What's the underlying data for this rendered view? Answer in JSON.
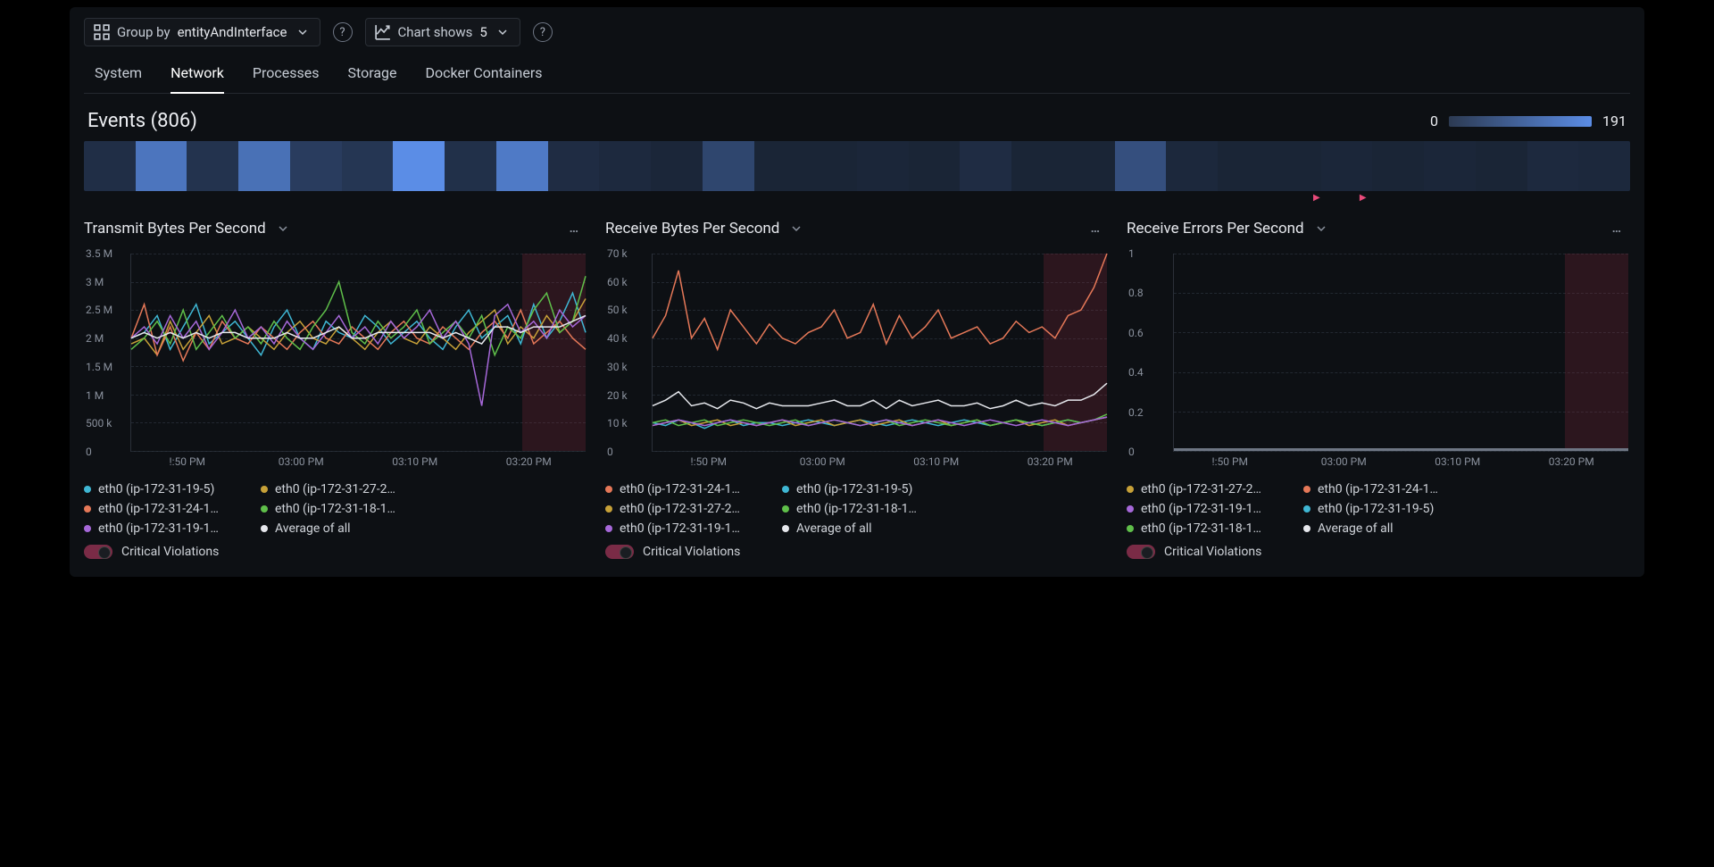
{
  "toolbar": {
    "group_by_label": "Group by",
    "group_by_value": "entityAndInterface",
    "chart_shows_label": "Chart shows",
    "chart_shows_value": "5"
  },
  "tabs": [
    "System",
    "Network",
    "Processes",
    "Storage",
    "Docker Containers"
  ],
  "active_tab": "Network",
  "events": {
    "title": "Events (806)",
    "scale_min": "0",
    "scale_max": "191",
    "heatmap": [
      20,
      95,
      25,
      90,
      35,
      28,
      120,
      22,
      100,
      18,
      15,
      12,
      45,
      10,
      10,
      12,
      10,
      18,
      10,
      10,
      55,
      14,
      10,
      10,
      12,
      10,
      12,
      10,
      15,
      14
    ]
  },
  "charts": [
    {
      "title": "Transmit Bytes Per Second",
      "legend": [
        {
          "color": "#3fb7d4",
          "label": "eth0 (ip-172-31-19-5)"
        },
        {
          "color": "#c7a138",
          "label": "eth0 (ip-172-31-27-2…"
        },
        {
          "color": "#e57858",
          "label": "eth0 (ip-172-31-24-1…"
        },
        {
          "color": "#5fbf4a",
          "label": "eth0 (ip-172-31-18-1…"
        },
        {
          "color": "#a668d9",
          "label": "eth0 (ip-172-31-19-1…"
        },
        {
          "color": "#e6e8ed",
          "label": "Average of all"
        }
      ],
      "critical_label": "Critical Violations"
    },
    {
      "title": "Receive Bytes Per Second",
      "legend": [
        {
          "color": "#e57858",
          "label": "eth0 (ip-172-31-24-1…"
        },
        {
          "color": "#3fb7d4",
          "label": "eth0 (ip-172-31-19-5)"
        },
        {
          "color": "#c7a138",
          "label": "eth0 (ip-172-31-27-2…"
        },
        {
          "color": "#5fbf4a",
          "label": "eth0 (ip-172-31-18-1…"
        },
        {
          "color": "#a668d9",
          "label": "eth0 (ip-172-31-19-1…"
        },
        {
          "color": "#e6e8ed",
          "label": "Average of all"
        }
      ],
      "critical_label": "Critical Violations"
    },
    {
      "title": "Receive Errors Per Second",
      "legend": [
        {
          "color": "#c7a138",
          "label": "eth0 (ip-172-31-27-2…"
        },
        {
          "color": "#e57858",
          "label": "eth0 (ip-172-31-24-1…"
        },
        {
          "color": "#a668d9",
          "label": "eth0 (ip-172-31-19-1…"
        },
        {
          "color": "#3fb7d4",
          "label": "eth0 (ip-172-31-19-5)"
        },
        {
          "color": "#5fbf4a",
          "label": "eth0 (ip-172-31-18-1…"
        },
        {
          "color": "#e6e8ed",
          "label": "Average of all"
        }
      ],
      "critical_label": "Critical Violations"
    }
  ],
  "chart_data": [
    {
      "type": "line",
      "title": "Transmit Bytes Per Second",
      "xlabel": "",
      "ylabel": "",
      "ylim": [
        0,
        3500000
      ],
      "y_ticks": [
        "3.5 M",
        "3 M",
        "2.5 M",
        "2 M",
        "1.5 M",
        "1 M",
        "500 k",
        "0"
      ],
      "x_ticks": [
        "!:50 PM",
        "03:00 PM",
        "03:10 PM",
        "03:20 PM"
      ],
      "x": [
        0,
        1,
        2,
        3,
        4,
        5,
        6,
        7,
        8,
        9,
        10,
        11,
        12,
        13,
        14,
        15,
        16,
        17,
        18,
        19,
        20,
        21,
        22,
        23,
        24,
        25,
        26,
        27,
        28,
        29,
        30,
        31,
        32,
        33,
        34,
        35
      ],
      "series": [
        {
          "name": "eth0 (ip-172-31-19-5)",
          "color": "#3fb7d4",
          "values": [
            2.0,
            2.1,
            2.4,
            1.8,
            2.2,
            2.6,
            1.9,
            2.1,
            2.3,
            2.0,
            1.7,
            2.2,
            2.5,
            2.0,
            1.8,
            2.3,
            2.1,
            2.0,
            2.4,
            2.2,
            1.9,
            2.1,
            2.3,
            2.0,
            1.8,
            2.2,
            2.5,
            2.0,
            2.2,
            2.4,
            1.9,
            2.6,
            2.0,
            2.3,
            2.8,
            2.1
          ]
        },
        {
          "name": "eth0 (ip-172-31-27-2)",
          "color": "#c7a138",
          "values": [
            1.9,
            2.0,
            1.7,
            2.3,
            1.8,
            2.1,
            2.4,
            1.9,
            2.0,
            2.2,
            2.0,
            1.8,
            2.1,
            2.3,
            2.0,
            1.9,
            2.2,
            2.0,
            1.8,
            2.1,
            2.3,
            2.0,
            1.9,
            2.2,
            2.0,
            1.8,
            2.1,
            2.3,
            2.5,
            1.9,
            2.2,
            2.0,
            2.4,
            2.1,
            2.3,
            2.7
          ]
        },
        {
          "name": "eth0 (ip-172-31-24-1)",
          "color": "#e57858",
          "values": [
            2.0,
            2.6,
            1.7,
            2.2,
            1.6,
            2.1,
            1.8,
            2.3,
            2.0,
            1.9,
            2.2,
            2.0,
            1.8,
            2.1,
            2.3,
            2.0,
            1.9,
            2.2,
            2.0,
            1.8,
            2.1,
            2.3,
            2.0,
            1.9,
            2.2,
            2.0,
            1.8,
            2.1,
            2.3,
            2.0,
            2.5,
            1.9,
            2.1,
            2.3,
            2.0,
            1.8
          ]
        },
        {
          "name": "eth0 (ip-172-31-18-1)",
          "color": "#5fbf4a",
          "values": [
            1.8,
            2.0,
            2.3,
            1.9,
            2.5,
            1.8,
            2.1,
            2.4,
            2.0,
            2.2,
            1.9,
            2.3,
            2.0,
            1.8,
            2.2,
            2.5,
            3.0,
            2.1,
            1.9,
            2.3,
            2.0,
            2.2,
            2.5,
            1.9,
            2.1,
            2.3,
            2.0,
            2.4,
            1.7,
            2.2,
            2.0,
            2.5,
            2.8,
            2.1,
            2.3,
            3.1
          ]
        },
        {
          "name": "eth0 (ip-172-31-19-1)",
          "color": "#a668d9",
          "values": [
            2.0,
            2.2,
            1.9,
            2.4,
            2.0,
            2.3,
            1.8,
            2.1,
            2.5,
            2.0,
            2.2,
            1.9,
            2.3,
            2.0,
            1.8,
            2.1,
            2.4,
            2.0,
            2.2,
            1.9,
            2.3,
            2.0,
            2.2,
            2.5,
            2.0,
            2.3,
            1.9,
            0.8,
            2.4,
            2.6,
            2.1,
            2.3,
            2.0,
            2.5,
            2.2,
            2.4
          ]
        },
        {
          "name": "Average of all",
          "color": "#e6e8ed",
          "values": [
            2.0,
            2.1,
            2.0,
            2.1,
            2.0,
            2.1,
            2.0,
            2.1,
            2.1,
            2.0,
            2.0,
            2.0,
            2.1,
            2.0,
            2.0,
            2.1,
            2.2,
            2.0,
            2.0,
            2.1,
            2.1,
            2.1,
            2.1,
            2.1,
            2.0,
            2.1,
            2.0,
            1.9,
            2.2,
            2.2,
            2.1,
            2.2,
            2.2,
            2.2,
            2.3,
            2.4
          ]
        }
      ],
      "critical_band": {
        "start_frac": 0.86,
        "end_frac": 1.0
      }
    },
    {
      "type": "line",
      "title": "Receive Bytes Per Second",
      "xlabel": "",
      "ylabel": "",
      "ylim": [
        0,
        70000
      ],
      "y_ticks": [
        "70 k",
        "60 k",
        "50 k",
        "40 k",
        "30 k",
        "20 k",
        "10 k",
        "0"
      ],
      "x_ticks": [
        "!:50 PM",
        "03:00 PM",
        "03:10 PM",
        "03:20 PM"
      ],
      "x": [
        0,
        1,
        2,
        3,
        4,
        5,
        6,
        7,
        8,
        9,
        10,
        11,
        12,
        13,
        14,
        15,
        16,
        17,
        18,
        19,
        20,
        21,
        22,
        23,
        24,
        25,
        26,
        27,
        28,
        29,
        30,
        31,
        32,
        33,
        34,
        35
      ],
      "series": [
        {
          "name": "eth0 (ip-172-31-24-1)",
          "color": "#e57858",
          "values": [
            40,
            48,
            64,
            40,
            47,
            36,
            50,
            44,
            38,
            45,
            40,
            38,
            42,
            44,
            50,
            40,
            42,
            52,
            38,
            48,
            40,
            44,
            50,
            40,
            42,
            44,
            38,
            40,
            46,
            42,
            44,
            40,
            48,
            50,
            58,
            70
          ]
        },
        {
          "name": "eth0 (ip-172-31-19-5)",
          "color": "#3fb7d4",
          "values": [
            10,
            9,
            11,
            10,
            8,
            10,
            11,
            9,
            10,
            10,
            9,
            10,
            11,
            10,
            9,
            10,
            11,
            10,
            9,
            10,
            11,
            10,
            9,
            10,
            11,
            10,
            9,
            10,
            11,
            10,
            9,
            10,
            11,
            10,
            11,
            12
          ]
        },
        {
          "name": "eth0 (ip-172-31-27-2)",
          "color": "#c7a138",
          "values": [
            9,
            10,
            11,
            9,
            10,
            11,
            9,
            10,
            9,
            10,
            11,
            9,
            10,
            11,
            9,
            10,
            11,
            9,
            10,
            11,
            9,
            10,
            11,
            9,
            10,
            11,
            9,
            10,
            11,
            9,
            10,
            11,
            9,
            10,
            11,
            12
          ]
        },
        {
          "name": "eth0 (ip-172-31-18-1)",
          "color": "#5fbf4a",
          "values": [
            10,
            11,
            9,
            10,
            11,
            9,
            10,
            11,
            10,
            9,
            10,
            11,
            9,
            10,
            11,
            10,
            9,
            10,
            11,
            9,
            10,
            11,
            10,
            9,
            10,
            11,
            9,
            10,
            11,
            10,
            9,
            10,
            11,
            10,
            11,
            13
          ]
        },
        {
          "name": "eth0 (ip-172-31-19-1)",
          "color": "#a668d9",
          "values": [
            9,
            10,
            11,
            10,
            9,
            10,
            11,
            10,
            9,
            10,
            11,
            10,
            9,
            10,
            11,
            10,
            9,
            10,
            11,
            10,
            9,
            10,
            11,
            10,
            9,
            10,
            11,
            10,
            9,
            10,
            11,
            10,
            9,
            10,
            11,
            12
          ]
        },
        {
          "name": "Average of all",
          "color": "#e6e8ed",
          "values": [
            16,
            18,
            21,
            16,
            17,
            15,
            18,
            17,
            15,
            17,
            16,
            16,
            16,
            17,
            18,
            16,
            16,
            18,
            15,
            18,
            16,
            17,
            18,
            16,
            16,
            17,
            15,
            16,
            18,
            16,
            17,
            16,
            18,
            18,
            20,
            24
          ]
        }
      ],
      "critical_band": {
        "start_frac": 0.86,
        "end_frac": 1.0
      }
    },
    {
      "type": "line",
      "title": "Receive Errors Per Second",
      "xlabel": "",
      "ylabel": "",
      "ylim": [
        0,
        1
      ],
      "y_ticks": [
        "1",
        "0.8",
        "0.6",
        "0.4",
        "0.2",
        "0"
      ],
      "x_ticks": [
        "!:50 PM",
        "03:00 PM",
        "03:10 PM",
        "03:20 PM"
      ],
      "x": [
        0,
        1,
        2,
        3,
        4,
        5,
        6,
        7,
        8,
        9,
        10,
        11,
        12,
        13,
        14,
        15,
        16,
        17,
        18,
        19,
        20,
        21,
        22,
        23,
        24,
        25,
        26,
        27,
        28,
        29,
        30,
        31,
        32,
        33,
        34,
        35
      ],
      "series": [
        {
          "name": "eth0 (ip-172-31-27-2)",
          "color": "#c7a138",
          "values": [
            0,
            0,
            0,
            0,
            0,
            0,
            0,
            0,
            0,
            0,
            0,
            0,
            0,
            0,
            0,
            0,
            0,
            0,
            0,
            0,
            0,
            0,
            0,
            0,
            0,
            0,
            0,
            0,
            0,
            0,
            0,
            0,
            0,
            0,
            0,
            0
          ]
        },
        {
          "name": "eth0 (ip-172-31-24-1)",
          "color": "#e57858",
          "values": [
            0,
            0,
            0,
            0,
            0,
            0,
            0,
            0,
            0,
            0,
            0,
            0,
            0,
            0,
            0,
            0,
            0,
            0,
            0,
            0,
            0,
            0,
            0,
            0,
            0,
            0,
            0,
            0,
            0,
            0,
            0,
            0,
            0,
            0,
            0,
            0
          ]
        },
        {
          "name": "eth0 (ip-172-31-19-1)",
          "color": "#a668d9",
          "values": [
            0,
            0,
            0,
            0,
            0,
            0,
            0,
            0,
            0,
            0,
            0,
            0,
            0,
            0,
            0,
            0,
            0,
            0,
            0,
            0,
            0,
            0,
            0,
            0,
            0,
            0,
            0,
            0,
            0,
            0,
            0,
            0,
            0,
            0,
            0,
            0
          ]
        },
        {
          "name": "eth0 (ip-172-31-19-5)",
          "color": "#3fb7d4",
          "values": [
            0,
            0,
            0,
            0,
            0,
            0,
            0,
            0,
            0,
            0,
            0,
            0,
            0,
            0,
            0,
            0,
            0,
            0,
            0,
            0,
            0,
            0,
            0,
            0,
            0,
            0,
            0,
            0,
            0,
            0,
            0,
            0,
            0,
            0,
            0,
            0
          ]
        },
        {
          "name": "eth0 (ip-172-31-18-1)",
          "color": "#5fbf4a",
          "values": [
            0,
            0,
            0,
            0,
            0,
            0,
            0,
            0,
            0,
            0,
            0,
            0,
            0,
            0,
            0,
            0,
            0,
            0,
            0,
            0,
            0,
            0,
            0,
            0,
            0,
            0,
            0,
            0,
            0,
            0,
            0,
            0,
            0,
            0,
            0,
            0
          ]
        },
        {
          "name": "Average of all",
          "color": "#e6e8ed",
          "values": [
            0,
            0,
            0,
            0,
            0,
            0,
            0,
            0,
            0,
            0,
            0,
            0,
            0,
            0,
            0,
            0,
            0,
            0,
            0,
            0,
            0,
            0,
            0,
            0,
            0,
            0,
            0,
            0,
            0,
            0,
            0,
            0,
            0,
            0,
            0,
            0
          ]
        }
      ],
      "critical_band": {
        "start_frac": 0.86,
        "end_frac": 1.0
      },
      "flat": true
    }
  ]
}
